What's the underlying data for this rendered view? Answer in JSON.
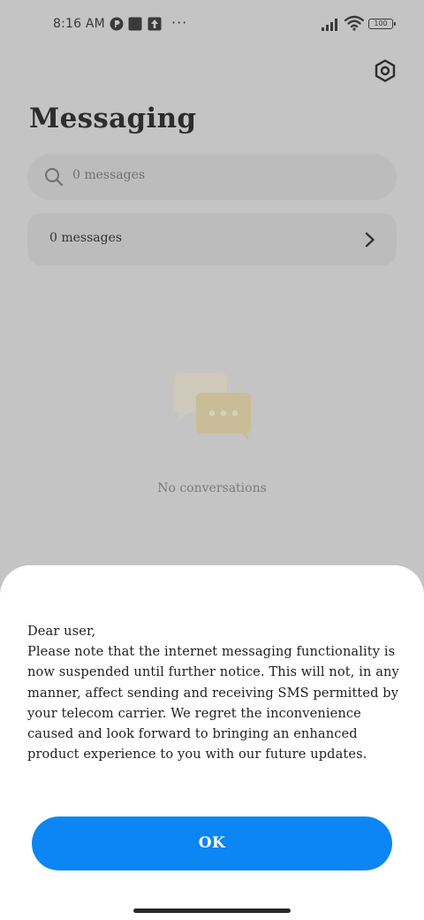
{
  "status_bar": {
    "time": "8:16 AM",
    "more": "···",
    "battery": "100"
  },
  "header": {
    "title": "Messaging"
  },
  "search": {
    "placeholder": "0 messages"
  },
  "summary_row": {
    "label": "0 messages"
  },
  "empty_state": {
    "text": "No conversations"
  },
  "dialog": {
    "greeting": "Dear user,",
    "body": "Please note that the internet messaging functionality is now suspended until further notice. This will not, in any manner, affect sending and receiving SMS permitted by your telecom carrier. We regret the inconvenience caused and look forward to bringing an enhanced product experience to you with our future updates.",
    "ok_label": "OK"
  },
  "colors": {
    "accent": "#0c85f5",
    "scrim_background": "#c4c4c4",
    "sheet_background": "#ffffff"
  },
  "icons": [
    "settings-gear-icon",
    "search-icon",
    "chevron-right-icon",
    "chat-bubbles-illustration",
    "signal-icon",
    "wifi-icon",
    "battery-icon"
  ]
}
